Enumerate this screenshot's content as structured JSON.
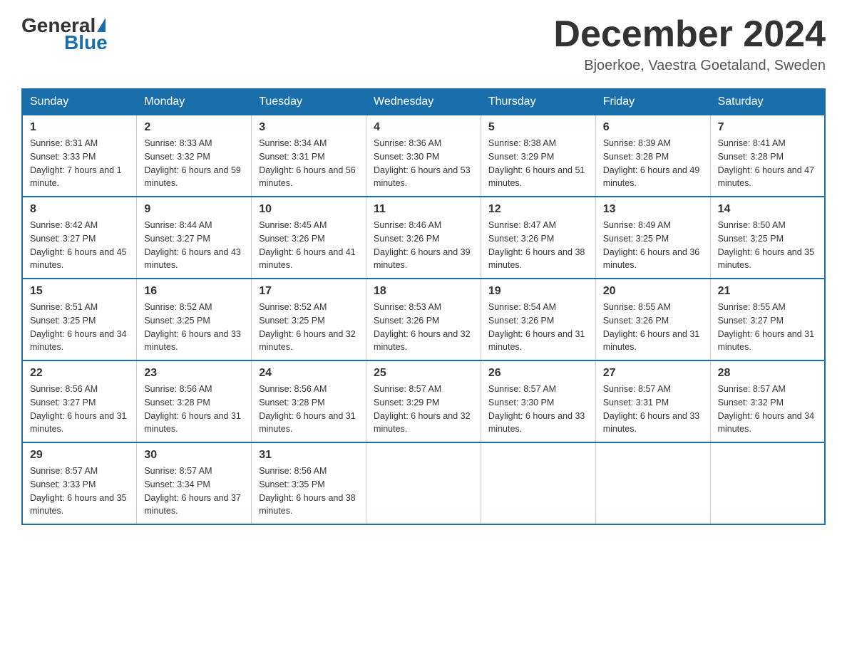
{
  "header": {
    "logo": {
      "general": "General",
      "blue": "Blue"
    },
    "title": "December 2024",
    "location": "Bjoerkoe, Vaestra Goetaland, Sweden"
  },
  "days_of_week": [
    "Sunday",
    "Monday",
    "Tuesday",
    "Wednesday",
    "Thursday",
    "Friday",
    "Saturday"
  ],
  "weeks": [
    [
      {
        "day": "1",
        "sunrise": "8:31 AM",
        "sunset": "3:33 PM",
        "daylight": "7 hours and 1 minute."
      },
      {
        "day": "2",
        "sunrise": "8:33 AM",
        "sunset": "3:32 PM",
        "daylight": "6 hours and 59 minutes."
      },
      {
        "day": "3",
        "sunrise": "8:34 AM",
        "sunset": "3:31 PM",
        "daylight": "6 hours and 56 minutes."
      },
      {
        "day": "4",
        "sunrise": "8:36 AM",
        "sunset": "3:30 PM",
        "daylight": "6 hours and 53 minutes."
      },
      {
        "day": "5",
        "sunrise": "8:38 AM",
        "sunset": "3:29 PM",
        "daylight": "6 hours and 51 minutes."
      },
      {
        "day": "6",
        "sunrise": "8:39 AM",
        "sunset": "3:28 PM",
        "daylight": "6 hours and 49 minutes."
      },
      {
        "day": "7",
        "sunrise": "8:41 AM",
        "sunset": "3:28 PM",
        "daylight": "6 hours and 47 minutes."
      }
    ],
    [
      {
        "day": "8",
        "sunrise": "8:42 AM",
        "sunset": "3:27 PM",
        "daylight": "6 hours and 45 minutes."
      },
      {
        "day": "9",
        "sunrise": "8:44 AM",
        "sunset": "3:27 PM",
        "daylight": "6 hours and 43 minutes."
      },
      {
        "day": "10",
        "sunrise": "8:45 AM",
        "sunset": "3:26 PM",
        "daylight": "6 hours and 41 minutes."
      },
      {
        "day": "11",
        "sunrise": "8:46 AM",
        "sunset": "3:26 PM",
        "daylight": "6 hours and 39 minutes."
      },
      {
        "day": "12",
        "sunrise": "8:47 AM",
        "sunset": "3:26 PM",
        "daylight": "6 hours and 38 minutes."
      },
      {
        "day": "13",
        "sunrise": "8:49 AM",
        "sunset": "3:25 PM",
        "daylight": "6 hours and 36 minutes."
      },
      {
        "day": "14",
        "sunrise": "8:50 AM",
        "sunset": "3:25 PM",
        "daylight": "6 hours and 35 minutes."
      }
    ],
    [
      {
        "day": "15",
        "sunrise": "8:51 AM",
        "sunset": "3:25 PM",
        "daylight": "6 hours and 34 minutes."
      },
      {
        "day": "16",
        "sunrise": "8:52 AM",
        "sunset": "3:25 PM",
        "daylight": "6 hours and 33 minutes."
      },
      {
        "day": "17",
        "sunrise": "8:52 AM",
        "sunset": "3:25 PM",
        "daylight": "6 hours and 32 minutes."
      },
      {
        "day": "18",
        "sunrise": "8:53 AM",
        "sunset": "3:26 PM",
        "daylight": "6 hours and 32 minutes."
      },
      {
        "day": "19",
        "sunrise": "8:54 AM",
        "sunset": "3:26 PM",
        "daylight": "6 hours and 31 minutes."
      },
      {
        "day": "20",
        "sunrise": "8:55 AM",
        "sunset": "3:26 PM",
        "daylight": "6 hours and 31 minutes."
      },
      {
        "day": "21",
        "sunrise": "8:55 AM",
        "sunset": "3:27 PM",
        "daylight": "6 hours and 31 minutes."
      }
    ],
    [
      {
        "day": "22",
        "sunrise": "8:56 AM",
        "sunset": "3:27 PM",
        "daylight": "6 hours and 31 minutes."
      },
      {
        "day": "23",
        "sunrise": "8:56 AM",
        "sunset": "3:28 PM",
        "daylight": "6 hours and 31 minutes."
      },
      {
        "day": "24",
        "sunrise": "8:56 AM",
        "sunset": "3:28 PM",
        "daylight": "6 hours and 31 minutes."
      },
      {
        "day": "25",
        "sunrise": "8:57 AM",
        "sunset": "3:29 PM",
        "daylight": "6 hours and 32 minutes."
      },
      {
        "day": "26",
        "sunrise": "8:57 AM",
        "sunset": "3:30 PM",
        "daylight": "6 hours and 33 minutes."
      },
      {
        "day": "27",
        "sunrise": "8:57 AM",
        "sunset": "3:31 PM",
        "daylight": "6 hours and 33 minutes."
      },
      {
        "day": "28",
        "sunrise": "8:57 AM",
        "sunset": "3:32 PM",
        "daylight": "6 hours and 34 minutes."
      }
    ],
    [
      {
        "day": "29",
        "sunrise": "8:57 AM",
        "sunset": "3:33 PM",
        "daylight": "6 hours and 35 minutes."
      },
      {
        "day": "30",
        "sunrise": "8:57 AM",
        "sunset": "3:34 PM",
        "daylight": "6 hours and 37 minutes."
      },
      {
        "day": "31",
        "sunrise": "8:56 AM",
        "sunset": "3:35 PM",
        "daylight": "6 hours and 38 minutes."
      },
      null,
      null,
      null,
      null
    ]
  ]
}
